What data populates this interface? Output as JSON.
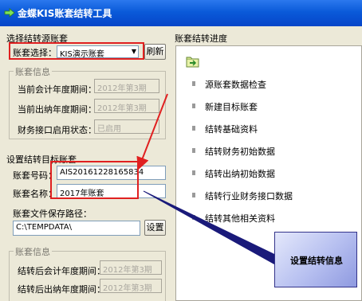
{
  "window": {
    "title": "金蝶KIS账套结转工具"
  },
  "source": {
    "section_title": "选择结转源账套",
    "account_label": "账套选择：",
    "account_value": "KIS演示账套",
    "refresh_label": "刷新",
    "info_group_title": "账套信息",
    "current_period_label": "当前会计年度期间：",
    "current_period_value": "2012年第3期",
    "current_cashier_label": "当前出纳年度期间：",
    "current_cashier_value": "2012年第3期",
    "interface_label": "财务接口启用状态：",
    "interface_value": "已启用"
  },
  "target": {
    "section_title": "设置结转目标账套",
    "number_label": "账套号码：",
    "number_value": "AIS20161228165834",
    "name_label": "账套名称：",
    "name_value": "2017年账套",
    "path_label": "账套文件保存路径：",
    "path_value": "C:\\TEMPDATA\\",
    "settings_label": "设置",
    "info_group_title": "账套信息",
    "after_period_label": "结转后会计年度期间：",
    "after_period_value": "2012年第3期",
    "after_cashier_label": "结转后出纳年度期间：",
    "after_cashier_value": "2012年第3期"
  },
  "progress": {
    "title": "账套结转进度",
    "steps": [
      "源账套数据检查",
      "新建目标账套",
      "结转基础资料",
      "结转财务初始数据",
      "结转出纳初始数据",
      "结转行业财务接口数据",
      "结转其他相关资料"
    ]
  },
  "callout": {
    "text": "设置结转信息"
  },
  "colors": {
    "titlebar": "#0a5ad9",
    "highlight": "#e02020",
    "callout_border": "#33338a"
  }
}
